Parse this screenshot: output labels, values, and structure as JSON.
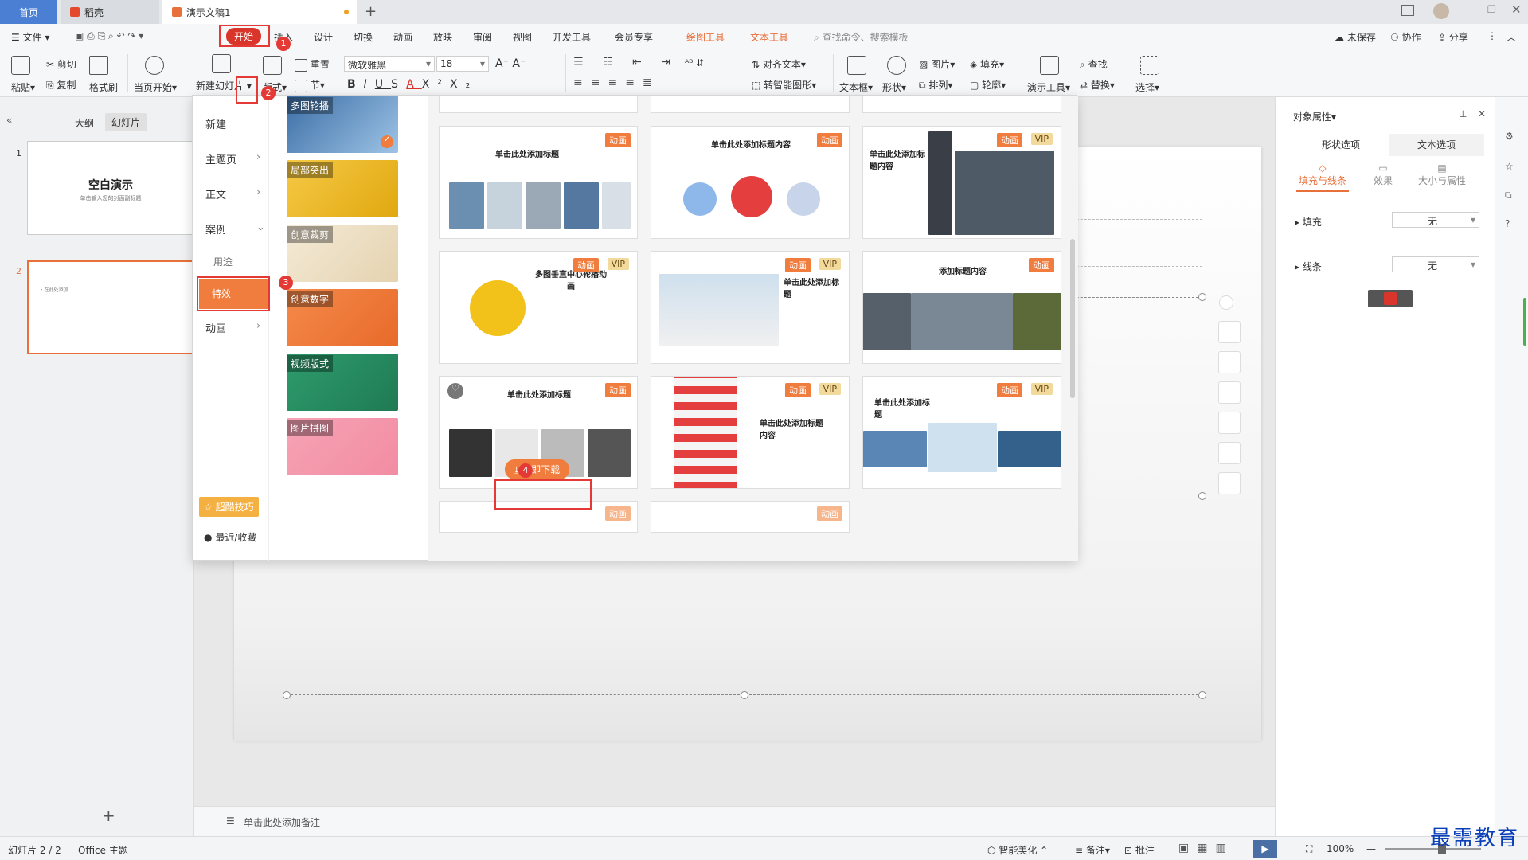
{
  "tabs": [
    {
      "label": "首页"
    },
    {
      "label": "稻壳"
    },
    {
      "label": "演示文稿1"
    }
  ],
  "menu": {
    "file": "文件",
    "start": "开始",
    "insert": "插入",
    "design": "设计",
    "transition": "切换",
    "animation": "动画",
    "slideshow": "放映",
    "review": "审阅",
    "view": "视图",
    "developer": "开发工具",
    "member": "会员专享",
    "drawing_tools": "绘图工具",
    "text_tools": "文本工具",
    "search_placeholder": "查找命令、搜索模板",
    "unsaved": "未保存",
    "collab": "协作",
    "share": "分享"
  },
  "ribbon": {
    "paste": "粘贴",
    "cut": "剪切",
    "copy": "复制",
    "format_painter": "格式刷",
    "from_current": "当页开始",
    "new_slide": "新建幻灯片",
    "layout": "版式",
    "reset": "重置",
    "section": "节",
    "font": "微软雅黑",
    "size": "18",
    "align_text": "对齐文本",
    "smartart": "转智能图形",
    "textbox": "文本框",
    "shape": "形状",
    "picture": "图片",
    "arrange": "排列",
    "fill": "填充",
    "outline": "轮廓",
    "present_tools": "演示工具",
    "find": "查找",
    "replace": "替换",
    "select": "选择"
  },
  "left": {
    "tab_outline": "大纲",
    "tab_slides": "幻灯片",
    "slide1_title": "空白演示",
    "slide1_sub": "单击输入您的封面副标题",
    "slide2_text": "• 在此处添加"
  },
  "dropdown": {
    "nav": [
      "新建",
      "主题页",
      "正文",
      "案例",
      "用途",
      "特效",
      "动画"
    ],
    "tips": "超酷技巧",
    "recent": "最近/收藏",
    "categories": [
      "多图轮播",
      "局部突出",
      "创意裁剪",
      "创意数字",
      "视频版式",
      "图片拼图"
    ],
    "download": "立即下载",
    "cards": [
      {
        "title": "单击此处添加标题",
        "badges": [
          "动画"
        ]
      },
      {
        "title": "单击此处添加标题内容",
        "badges": [
          "动画"
        ]
      },
      {
        "title": "单击此处添加标题内容",
        "badges": [
          "动画",
          "VIP"
        ]
      },
      {
        "title": "多图垂直中心轮播动画",
        "badges": [
          "动画",
          "VIP"
        ]
      },
      {
        "title": "单击此处添加标题",
        "badges": [
          "动画",
          "VIP"
        ]
      },
      {
        "title": "添加标题内容",
        "badges": [
          "动画"
        ]
      },
      {
        "title": "单击此处添加标题",
        "badges": [
          "动画"
        ]
      },
      {
        "title": "单击此处添加标题内容",
        "badges": [
          "动画",
          "VIP"
        ]
      },
      {
        "title": "单击此处添加标题",
        "badges": [
          "动画",
          "VIP"
        ]
      }
    ]
  },
  "notes": "单击此处添加备注",
  "props": {
    "title": "对象属性",
    "tab_shape": "形状选项",
    "tab_text": "文本选项",
    "sub_fill": "填充与线条",
    "sub_effect": "效果",
    "sub_size": "大小与属性",
    "fill": "填充",
    "fill_val": "无",
    "line": "线条",
    "line_val": "无"
  },
  "status": {
    "slide": "幻灯片 2 / 2",
    "theme": "Office 主题",
    "beautify": "智能美化",
    "notes": "备注",
    "comment": "批注",
    "zoom": "100%"
  },
  "watermark": "最需教育",
  "steps": [
    "1",
    "2",
    "3",
    "4"
  ],
  "colors": {
    "accent": "#e53935",
    "orange": "#f07d3d",
    "wps_red": "#d9352a"
  }
}
